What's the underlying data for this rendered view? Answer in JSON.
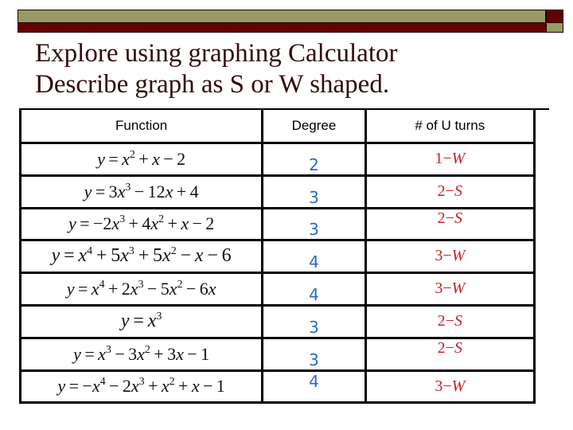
{
  "slide": {
    "title_lines": [
      "Explore using graphing Calculator",
      "Describe graph as S or W shaped."
    ],
    "colors": {
      "olive": "#999966",
      "maroon": "#660000",
      "title": "#330a0a",
      "degree": "#2a6ac8",
      "turns": "#c8202a"
    }
  },
  "table": {
    "headers": [
      "Function",
      "Degree",
      "# of U turns"
    ],
    "rows": [
      {
        "function": "y = x² + x − 2",
        "degree": "2",
        "turns": "1−W"
      },
      {
        "function": "y = 3x³ − 12x + 4",
        "degree": "3",
        "turns": "2−S"
      },
      {
        "function": "y = −2x³ + 4x² + x − 2",
        "degree": "3",
        "turns": "2−S"
      },
      {
        "function": "y = x⁴ + 5x³ + 5x² − x − 6",
        "degree": "4",
        "turns": "3−W"
      },
      {
        "function": "y = x⁴ + 2x³ − 5x² − 6x",
        "degree": "4",
        "turns": "3−W"
      },
      {
        "function": "y = x³",
        "degree": "3",
        "turns": "2−S"
      },
      {
        "function": "y = x³ − 3x² + 3x − 1",
        "degree": "3",
        "turns": "2−S"
      },
      {
        "function": "y = −x⁴ − 2x³ + x² + x − 1",
        "degree": "4",
        "turns": "3−W"
      }
    ]
  }
}
